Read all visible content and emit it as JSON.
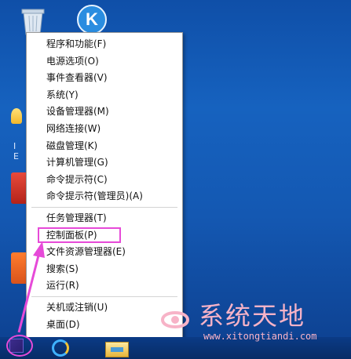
{
  "menu": {
    "items": [
      {
        "label": "程序和功能(F)"
      },
      {
        "label": "电源选项(O)"
      },
      {
        "label": "事件查看器(V)"
      },
      {
        "label": "系统(Y)"
      },
      {
        "label": "设备管理器(M)"
      },
      {
        "label": "网络连接(W)"
      },
      {
        "label": "磁盘管理(K)"
      },
      {
        "label": "计算机管理(G)"
      },
      {
        "label": "命令提示符(C)"
      },
      {
        "label": "命令提示符(管理员)(A)"
      },
      {
        "label": "任务管理器(T)"
      },
      {
        "label": "控制面板(P)"
      },
      {
        "label": "文件资源管理器(E)"
      },
      {
        "label": "搜索(S)"
      },
      {
        "label": "运行(R)"
      },
      {
        "label": "关机或注销(U)"
      },
      {
        "label": "桌面(D)"
      }
    ]
  },
  "desktop": {
    "k_icon_letter": "K",
    "left_icon_caption_1": "I",
    "left_icon_caption_2": "E"
  },
  "watermark": {
    "title": "系统天地",
    "url": "www.xitongtiandi.com"
  },
  "colors": {
    "highlight": "#e64ad8",
    "desktop_blue": "#1458b2",
    "watermark": "#f7b3c7"
  },
  "icons": {
    "start": "windows-start-icon",
    "ie": "internet-explorer-icon",
    "explorer": "file-explorer-icon",
    "recycle": "recycle-bin-icon",
    "k_app": "k-app-icon"
  }
}
